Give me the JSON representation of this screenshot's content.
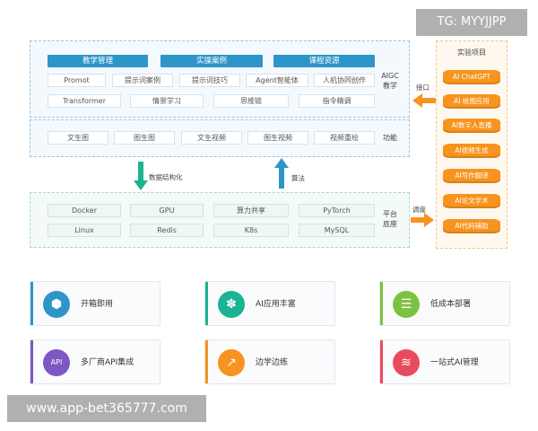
{
  "aigc_section": {
    "headers": [
      "教学管理",
      "实操案例",
      "课程资源"
    ],
    "row1": [
      "Promot",
      "提示词案例",
      "提示词技巧",
      "Agent智能体",
      "人机协同创作"
    ],
    "row2": [
      "Transformer",
      "情景学习",
      "思维链",
      "指令精调"
    ],
    "side_label": [
      "AIGC",
      "教学"
    ]
  },
  "function_section": {
    "items": [
      "文生图",
      "图生图",
      "文生视频",
      "图生视频",
      "视频重绘"
    ],
    "side_label": "功能"
  },
  "arrows": {
    "down_label": "数据结构化",
    "up_label": "算法",
    "interface_label": "接口",
    "schedule_label": "调度"
  },
  "platform_section": {
    "row1": [
      "Docker",
      "GPU",
      "算力共享",
      "PyTorch"
    ],
    "row2": [
      "Linux",
      "Redis",
      "K8s",
      "MySQL"
    ],
    "side_label": [
      "平台",
      "底座"
    ]
  },
  "experiments": {
    "title": "实验项目",
    "items": [
      "AI ChatGPT",
      "AI 绘图应用",
      "AI数字人直播",
      "AI视频生成",
      "AI写作翻译",
      "AI论文学术",
      "AI代码辅助"
    ],
    "color": "#f7931e"
  },
  "features": [
    {
      "label": "开箱即用",
      "icon": "box-icon",
      "glyph": "⬢",
      "color": "#2e95c9"
    },
    {
      "label": "AI应用丰富",
      "icon": "flower-icon",
      "glyph": "✽",
      "color": "#1ab394"
    },
    {
      "label": "低成本部署",
      "icon": "database-icon",
      "glyph": "☰",
      "color": "#7cc242"
    },
    {
      "label": "多厂商API集成",
      "icon": "api-icon",
      "glyph": "API",
      "color": "#7e57c2"
    },
    {
      "label": "边学边练",
      "icon": "chart-icon",
      "glyph": "↗",
      "color": "#f7931e"
    },
    {
      "label": "一站式AI管理",
      "icon": "layers-icon",
      "glyph": "≋",
      "color": "#e84c5c"
    }
  ],
  "watermarks": {
    "top": "TG: MYYJJPP",
    "bottom": "www.app-bet365777.com"
  }
}
